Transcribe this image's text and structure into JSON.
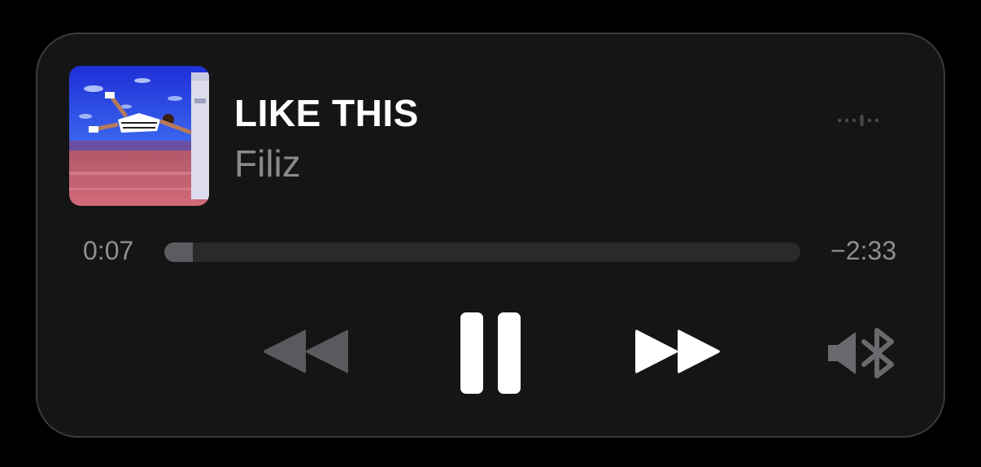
{
  "now_playing": {
    "title": "LIKE THIS",
    "artist": "Filiz"
  },
  "progress": {
    "elapsed": "0:07",
    "remaining": "−2:33",
    "fraction": 0.045
  },
  "controls": {
    "rewind_icon": "backward-icon",
    "pause_icon": "pause-icon",
    "forward_icon": "forward-icon",
    "route_icon": "speaker-bluetooth-icon",
    "waveform_icon": "audio-waveform-icon"
  },
  "colors": {
    "background": "#000000",
    "card": "#151515",
    "primary_text": "#ffffff",
    "secondary_text": "#8a8a8e",
    "disabled_control": "#5a5a5e"
  }
}
